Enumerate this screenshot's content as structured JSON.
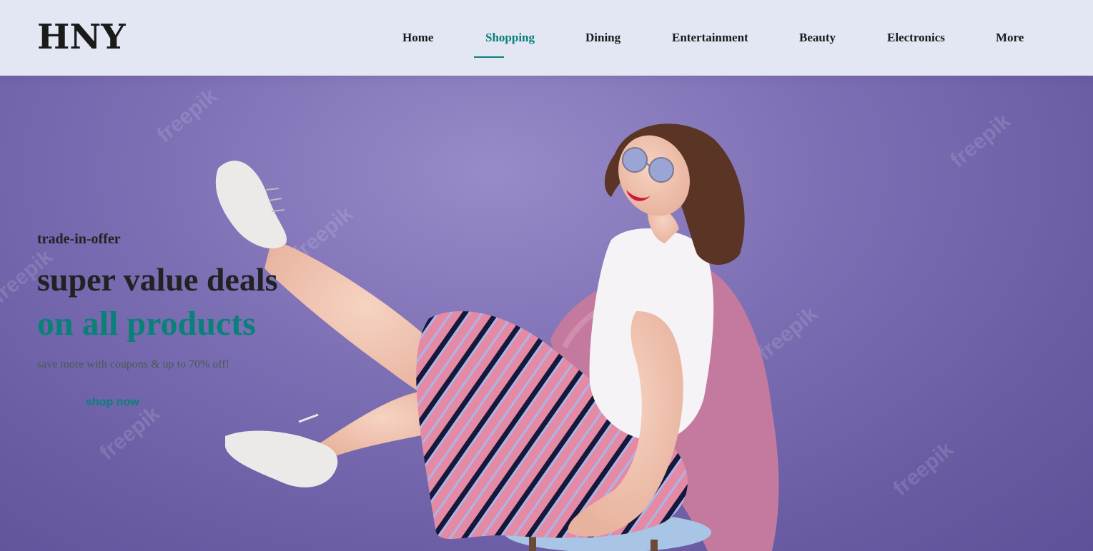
{
  "header": {
    "logo": "HNY",
    "nav": [
      {
        "label": "Home",
        "active": false
      },
      {
        "label": "Shopping",
        "active": true
      },
      {
        "label": "Dining",
        "active": false
      },
      {
        "label": "Entertainment",
        "active": false
      },
      {
        "label": "Beauty",
        "active": false
      },
      {
        "label": "Electronics",
        "active": false
      },
      {
        "label": "More",
        "active": false
      }
    ]
  },
  "hero": {
    "kicker": "trade-in-offer",
    "headline": "super value deals",
    "headline_accent": "on all products",
    "subline": "save more with coupons & up to 70% off!",
    "cta_label": "shop now",
    "watermark": "freepik",
    "image": "woman-sitting-on-chair-raising-leg"
  },
  "colors": {
    "accent": "#088178",
    "header_bg": "#e3e6f3",
    "hero_bg": "#7d6fb4",
    "text_dark": "#222222"
  }
}
